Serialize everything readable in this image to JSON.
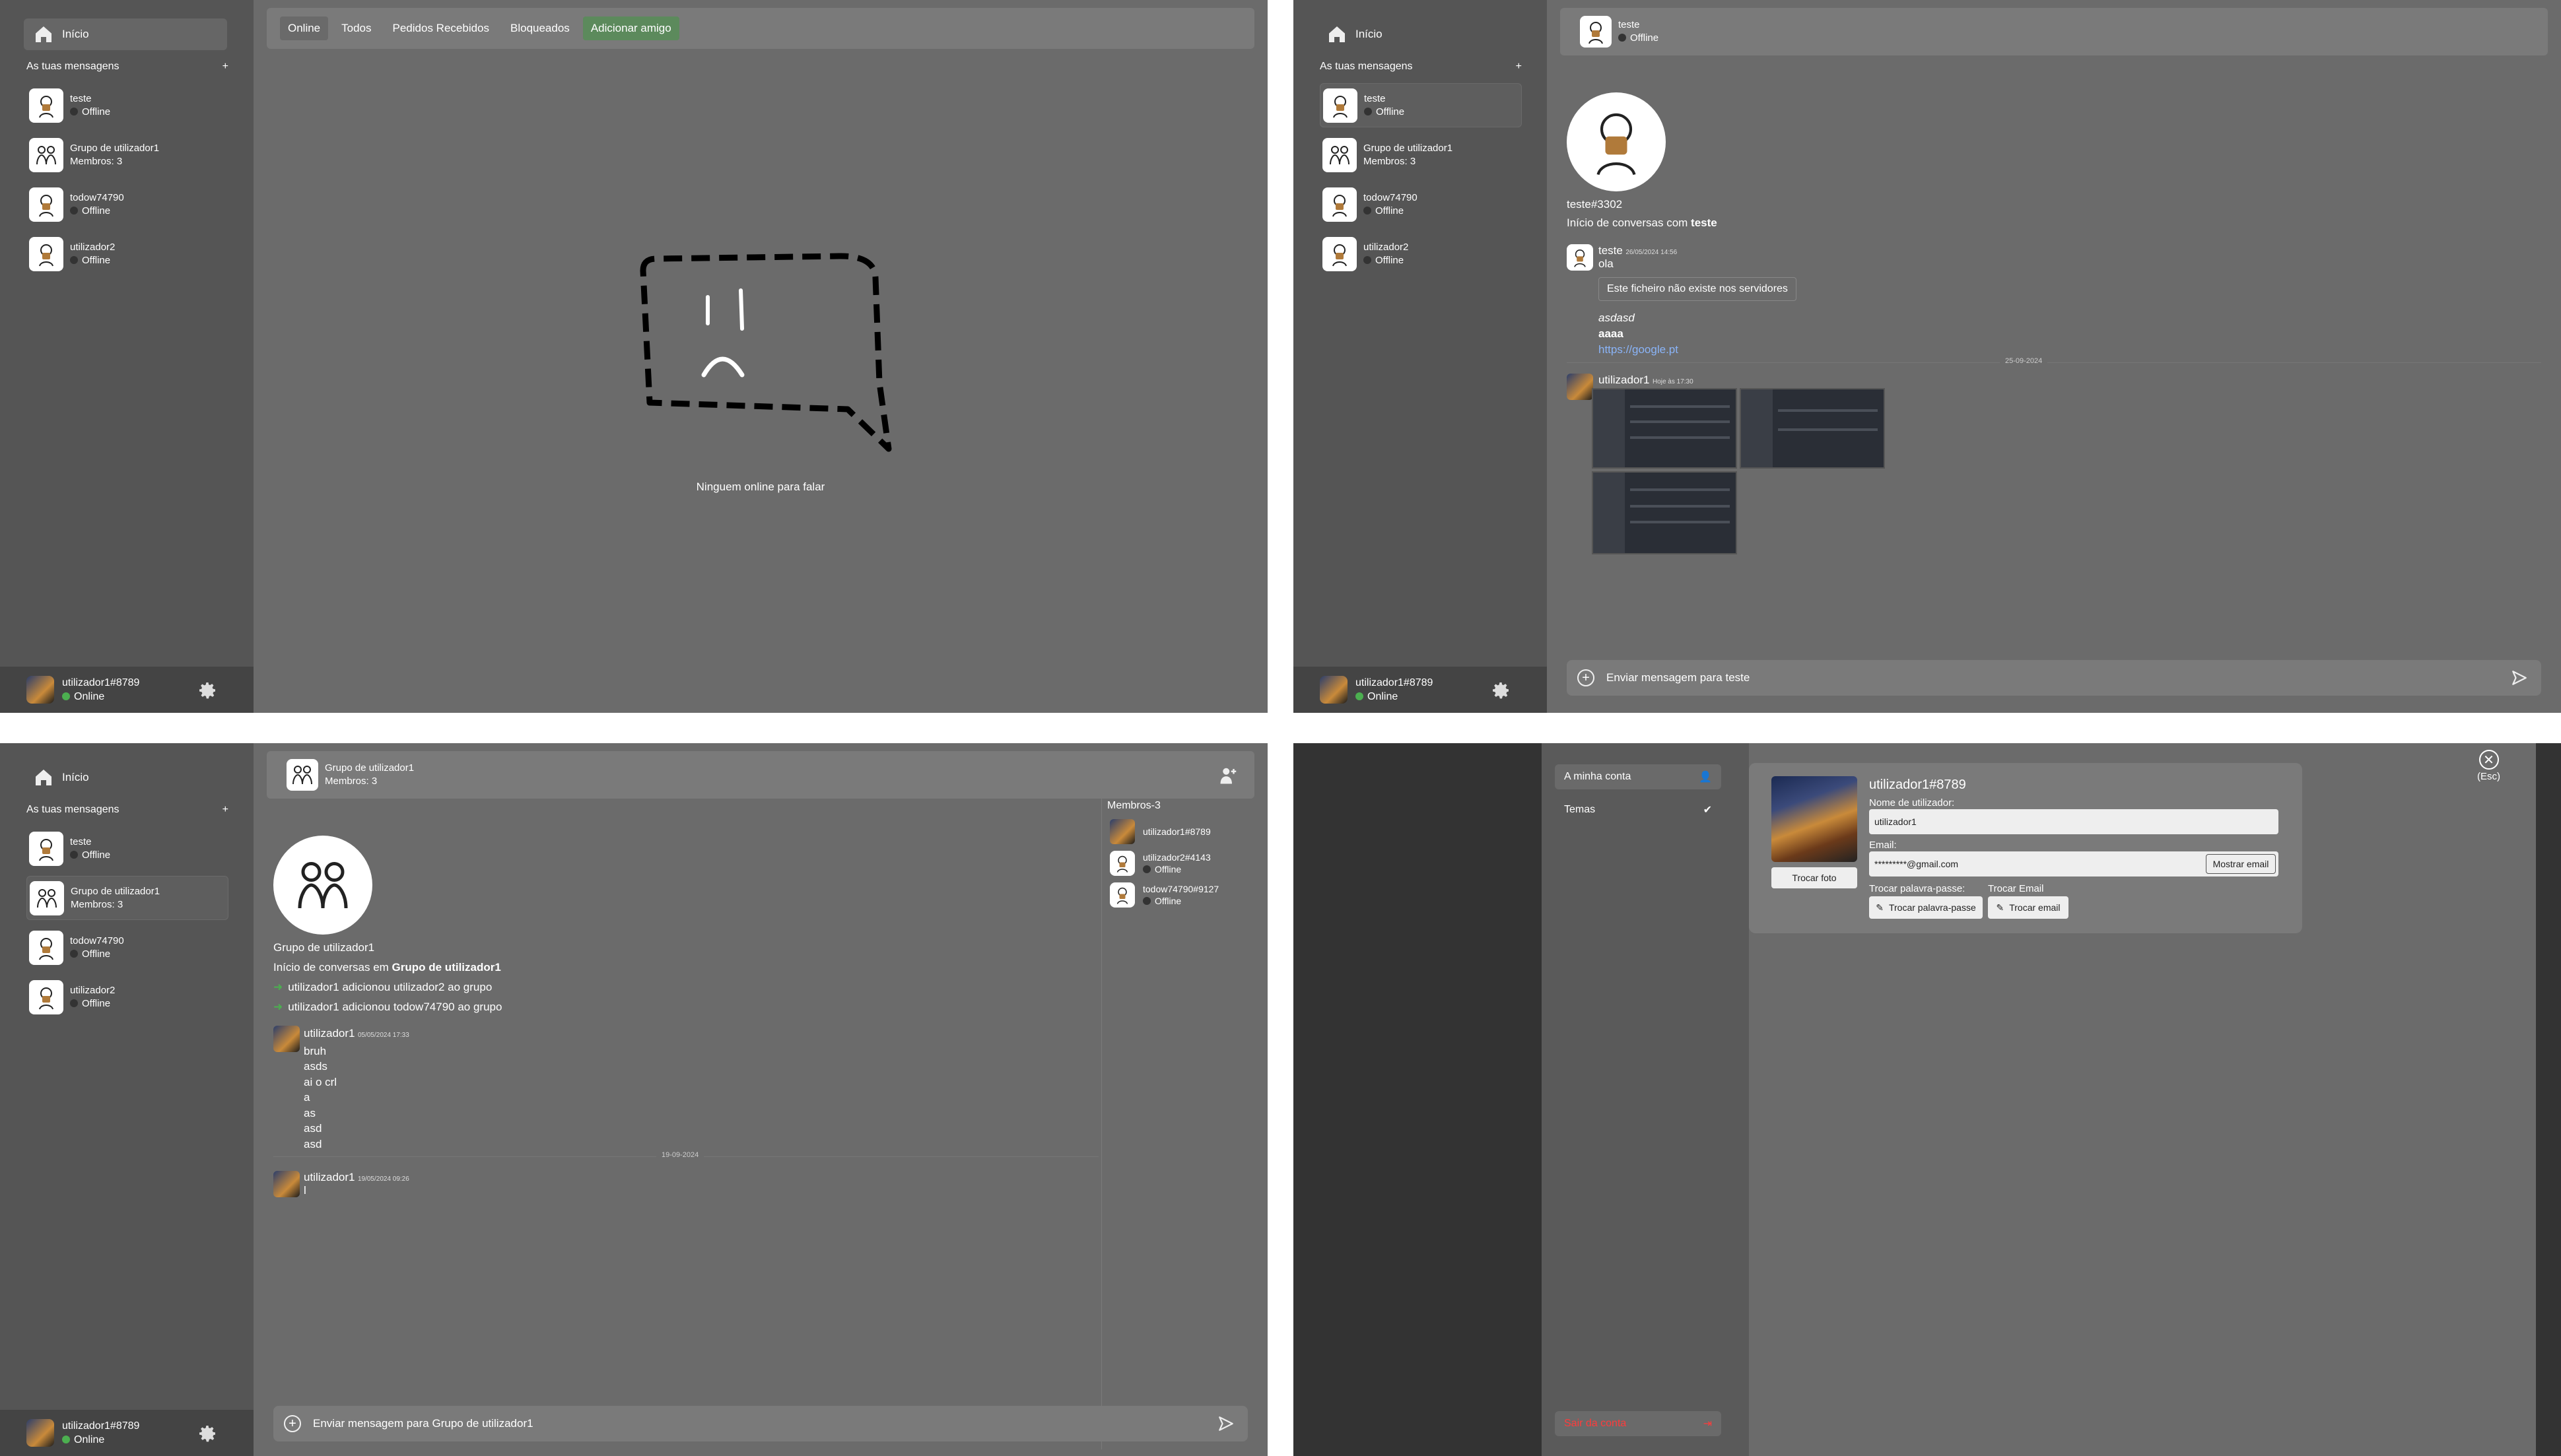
{
  "sidebar": {
    "home_label": "Início",
    "dm_header": "As tuas mensagens",
    "add_symbol": "+",
    "conversations": [
      {
        "name": "teste",
        "status": "Offline"
      },
      {
        "name": "Grupo de utilizador1",
        "status": "Membros: 3"
      },
      {
        "name": "todow74790",
        "status": "Offline"
      },
      {
        "name": "utilizador2",
        "status": "Offline"
      }
    ],
    "user": {
      "name": "utilizador1#8789",
      "status": "Online"
    }
  },
  "friends": {
    "tabs": [
      "Online",
      "Todos",
      "Pedidos Recebidos",
      "Bloqueados",
      "Adicionar amigo"
    ],
    "empty_message": "Ninguem online para falar"
  },
  "dm_chat": {
    "header_name": "teste",
    "header_status": "Offline",
    "profile_tag": "teste#3302",
    "intro_prefix": "Início de conversas com ",
    "intro_name": "teste",
    "msg1": {
      "author": "teste",
      "time": "26/05/2024 14:56",
      "lines": [
        "ola"
      ],
      "file_notice": "Este ficheiro não existe nos servidores",
      "italic": "asdasd",
      "bold": "aaaa",
      "link": "https://google.pt"
    },
    "date_divider": "25-09-2024",
    "msg2": {
      "author": "utilizador1",
      "time": "Hoje às 17:30"
    },
    "input_placeholder": "Enviar mensagem para teste"
  },
  "group_chat": {
    "header_name": "Grupo de utilizador1",
    "header_status": "Membros: 3",
    "group_title": "Grupo de utilizador1",
    "intro_prefix": "Início de conversas em ",
    "intro_name": "Grupo de utilizador1",
    "events": [
      "utilizador1 adicionou utilizador2 ao grupo",
      "utilizador1 adicionou todow74790 ao grupo"
    ],
    "msg1": {
      "author": "utilizador1",
      "time": "05/05/2024 17:33",
      "lines": [
        "bruh",
        "asds",
        "ai o crl",
        "a",
        "as",
        "asd",
        "asd"
      ]
    },
    "date_divider": "19-09-2024",
    "msg2": {
      "author": "utilizador1",
      "time": "19/05/2024 09:26",
      "lines": [
        "l"
      ]
    },
    "input_placeholder": "Enviar mensagem para Grupo de utilizador1",
    "members_header": "Membros-3",
    "members": [
      {
        "name": "utilizador1#8789",
        "status": ""
      },
      {
        "name": "utilizador2#4143",
        "status": "Offline"
      },
      {
        "name": "todow74790#9127",
        "status": "Offline"
      }
    ]
  },
  "settings": {
    "menu_account": "A minha conta",
    "menu_themes": "Temas",
    "logout": "Sair da conta",
    "username_display": "utilizador1#8789",
    "username_label": "Nome de utilizador:",
    "username_value": "utilizador1",
    "email_label": "Email:",
    "email_value": "*********@gmail.com",
    "show_email": "Mostrar email",
    "change_photo": "Trocar foto",
    "change_password_label": "Trocar palavra-passe:",
    "change_email_label": "Trocar Email",
    "change_password_btn": "Trocar palavra-passe",
    "change_email_btn": "Trocar email",
    "close_label": "(Esc)",
    "close_symbol": "✕"
  },
  "colors": {
    "online": "#4caf50",
    "add_friend": "#5c8a5c",
    "logout": "#ff3b3b",
    "link": "#8ab4f8"
  }
}
